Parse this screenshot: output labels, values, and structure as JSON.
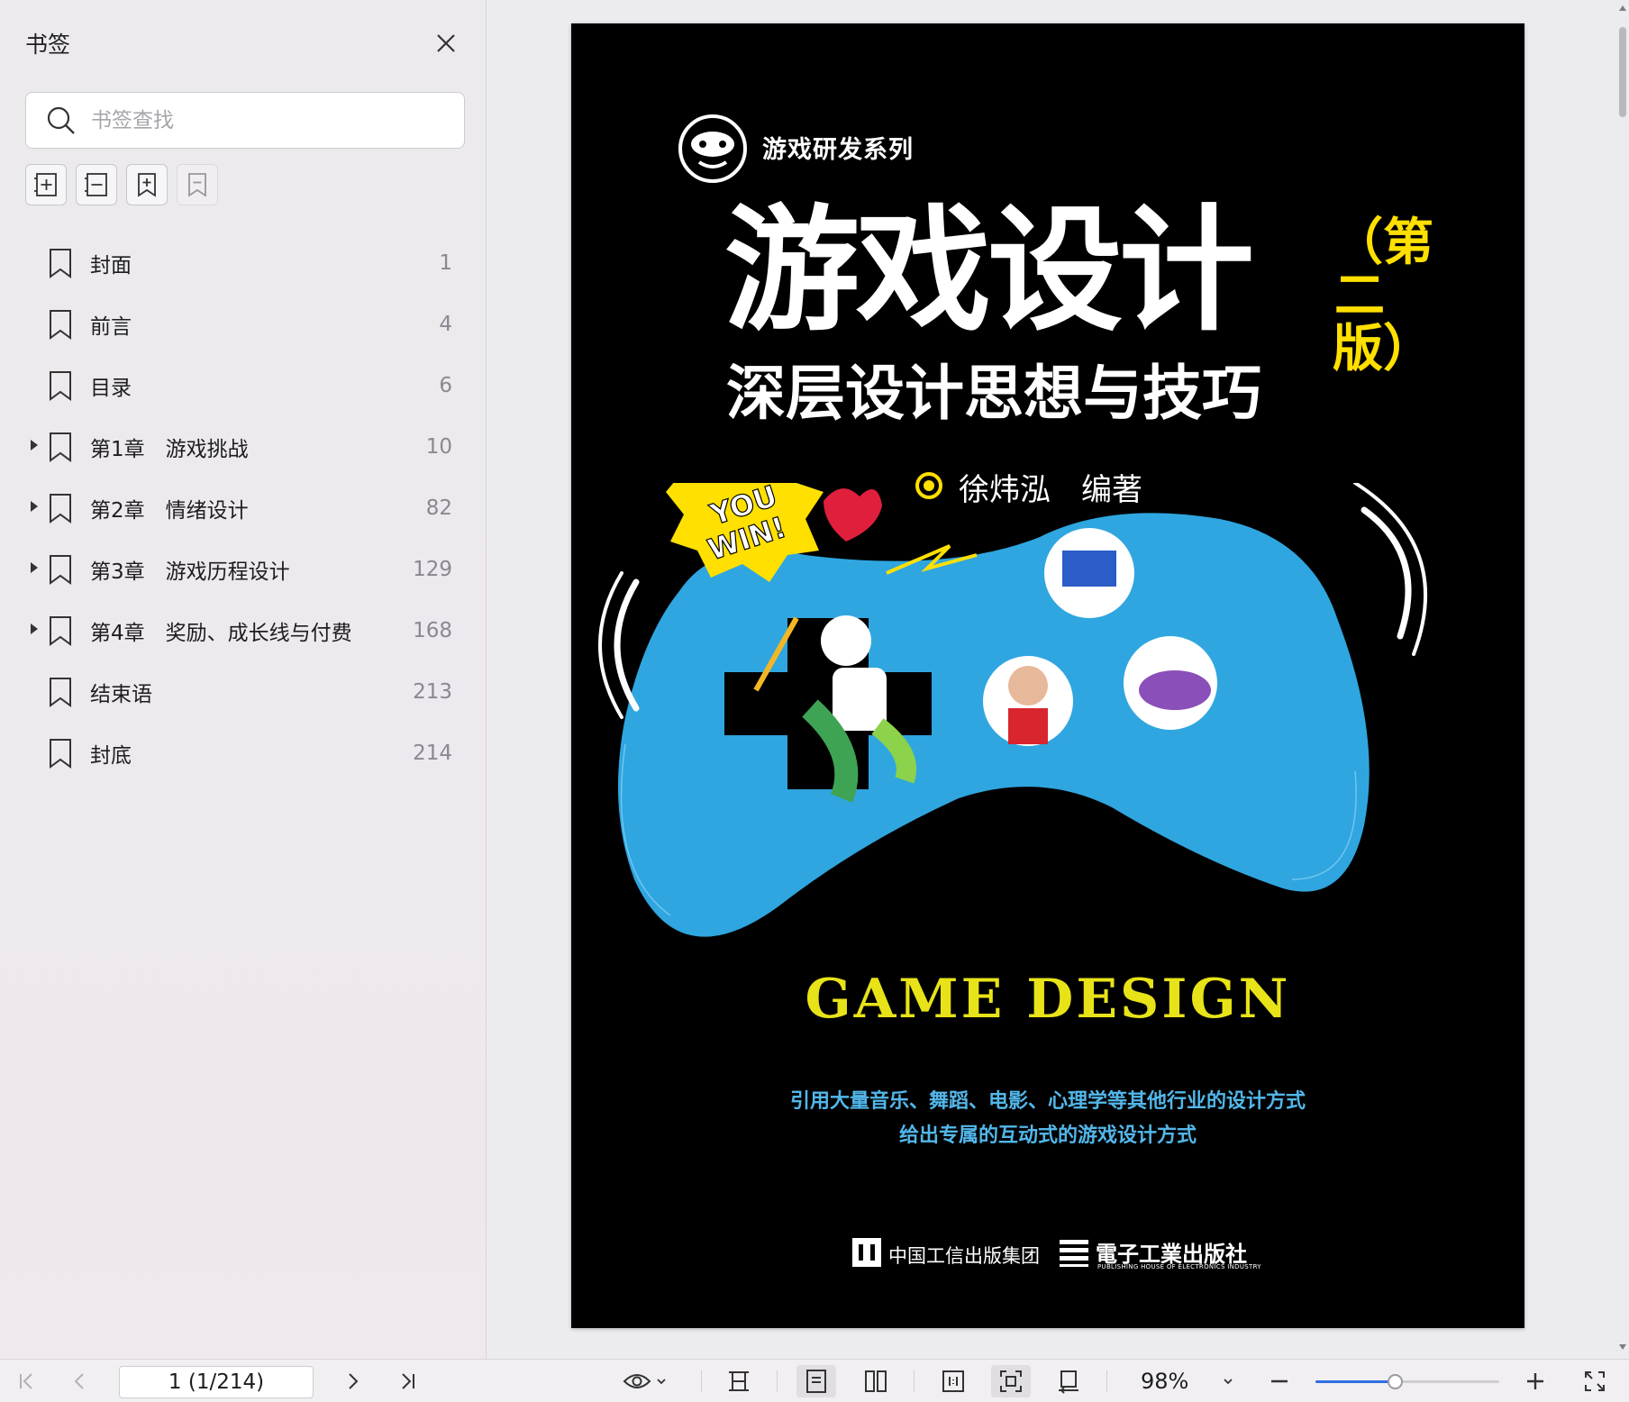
{
  "sidebar": {
    "title": "书签",
    "search_placeholder": "书签查找",
    "tools": [
      "add-bookmark-icon",
      "remove-bookmark-icon",
      "bookmark-add-icon",
      "bookmark-disabled-icon"
    ],
    "items": [
      {
        "label": "封面",
        "page": "1",
        "expandable": false
      },
      {
        "label": "前言",
        "page": "4",
        "expandable": false
      },
      {
        "label": "目录",
        "page": "6",
        "expandable": false
      },
      {
        "label": "第1章　游戏挑战",
        "page": "10",
        "expandable": true
      },
      {
        "label": "第2章　情绪设计",
        "page": "82",
        "expandable": true
      },
      {
        "label": "第3章　游戏历程设计",
        "page": "129",
        "expandable": true
      },
      {
        "label": "第4章　奖励、成长线与付费",
        "page": "168",
        "expandable": true
      },
      {
        "label": "结束语",
        "page": "213",
        "expandable": false
      },
      {
        "label": "封底",
        "page": "214",
        "expandable": false
      }
    ]
  },
  "cover": {
    "series": "游戏研发系列",
    "title": "游戏设计",
    "subtitle": "深层设计思想与技巧",
    "edition": "（第二版）",
    "author": "徐炜泓　编著",
    "badge": "YOU WIN!",
    "english_title": "GAME DESIGN",
    "tagline1": "引用大量音乐、舞蹈、电影、心理学等其他行业的设计方式",
    "tagline2": "给出专属的互动式的游戏设计方式",
    "publisher1": "中国工信出版集团",
    "publisher2": "電子工業出版社",
    "publisher2_en": "PUBLISHING HOUSE OF ELECTRONICS INDUSTRY",
    "colors": {
      "background": "#000000",
      "blob": "#2fa6e0",
      "accent": "#ffe000",
      "tagline": "#52b7ea"
    }
  },
  "toolbar": {
    "page_value": "1 (1/214)",
    "zoom": "98%",
    "zoom_fraction": 0.43
  }
}
